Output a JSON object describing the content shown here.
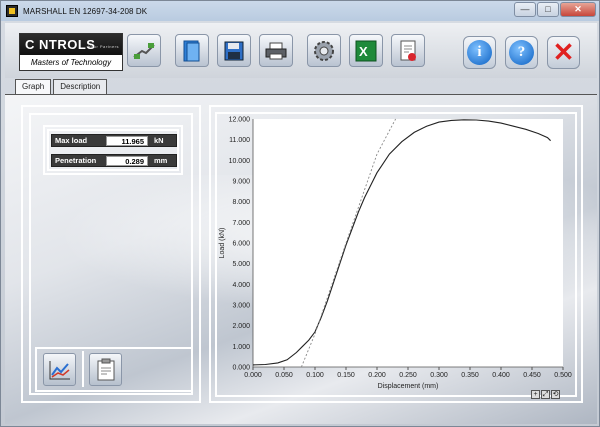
{
  "window": {
    "title": "MARSHALL EN 12697-34-208 DK",
    "controls": {
      "minimize": "—",
      "maximize": "□",
      "close": "✕"
    }
  },
  "logo": {
    "brand": "C NTROLS",
    "tagline": "Your Partners",
    "subtitle": "Masters of Technology"
  },
  "toolbar": {
    "buttons": [
      {
        "name": "connect-button",
        "icon": "cable-plug-icon"
      },
      {
        "name": "open-button",
        "icon": "folder-open-icon"
      },
      {
        "name": "save-button",
        "icon": "floppy-disk-icon"
      },
      {
        "name": "print-button",
        "icon": "printer-icon"
      },
      {
        "name": "settings-button",
        "icon": "gear-icon"
      },
      {
        "name": "excel-export-button",
        "icon": "excel-icon"
      },
      {
        "name": "export-pdf-button",
        "icon": "document-export-icon"
      }
    ],
    "info_label": "i",
    "help_label": "?",
    "exit_label": "✕"
  },
  "tabs": [
    {
      "label": "Graph",
      "active": true
    },
    {
      "label": "Description",
      "active": false
    }
  ],
  "readouts": {
    "max_load": {
      "label": "Max load",
      "value": "11.965",
      "unit": "kN"
    },
    "penetration": {
      "label": "Penetration",
      "value": "0.289",
      "unit": "mm"
    }
  },
  "bottom_buttons": [
    {
      "name": "graph-analysis-button",
      "icon": "chart-analysis-icon"
    },
    {
      "name": "report-button",
      "icon": "clipboard-icon"
    }
  ],
  "zoom_tools": [
    "+",
    "⤢",
    "⟲"
  ],
  "chart_data": {
    "type": "line",
    "xlabel": "Displacement (mm)",
    "ylabel": "Load (kN)",
    "xlim": [
      0.0,
      0.5
    ],
    "ylim": [
      0.0,
      12.0
    ],
    "x_ticks": [
      "0.000",
      "0.050",
      "0.100",
      "0.150",
      "0.200",
      "0.250",
      "0.300",
      "0.350",
      "0.400",
      "0.450",
      "0.500"
    ],
    "y_ticks": [
      "0.000",
      "1.000",
      "2.000",
      "3.000",
      "4.000",
      "5.000",
      "6.000",
      "7.000",
      "8.000",
      "9.000",
      "10.000",
      "11.000",
      "12.000"
    ],
    "grid": false,
    "series": [
      {
        "style": "solid",
        "x": [
          0.0,
          0.02,
          0.04,
          0.055,
          0.07,
          0.08,
          0.09,
          0.1,
          0.11,
          0.12,
          0.13,
          0.14,
          0.15,
          0.16,
          0.17,
          0.18,
          0.19,
          0.2,
          0.22,
          0.24,
          0.26,
          0.28,
          0.3,
          0.32,
          0.34,
          0.36,
          0.38,
          0.4,
          0.42,
          0.44,
          0.46,
          0.475,
          0.48
        ],
        "y": [
          0.1,
          0.12,
          0.2,
          0.35,
          0.7,
          1.0,
          1.3,
          1.7,
          2.4,
          3.2,
          4.1,
          5.0,
          5.9,
          6.7,
          7.5,
          8.2,
          8.8,
          9.4,
          10.3,
          10.9,
          11.35,
          11.65,
          11.85,
          11.93,
          11.96,
          11.95,
          11.9,
          11.8,
          11.65,
          11.5,
          11.3,
          11.1,
          10.95
        ]
      },
      {
        "style": "dashed",
        "x": [
          0.078,
          0.1,
          0.15,
          0.2,
          0.23
        ],
        "y": [
          0.0,
          1.6,
          6.0,
          10.3,
          12.0
        ]
      }
    ]
  }
}
